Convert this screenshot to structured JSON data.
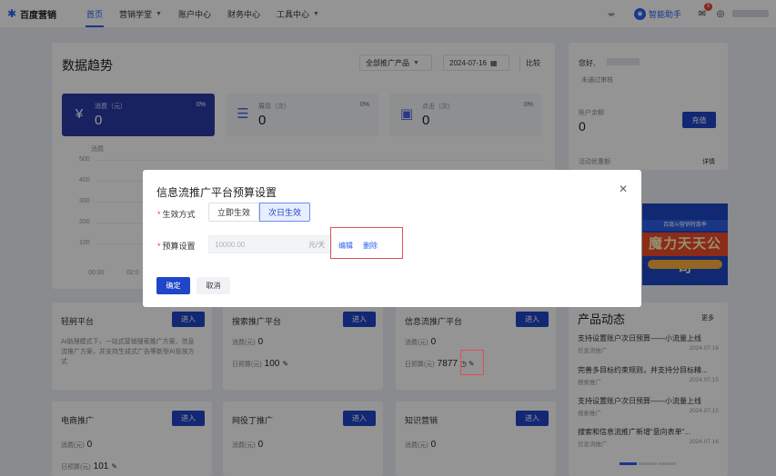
{
  "nav": {
    "logo_text": "百度营销",
    "items": [
      {
        "label": "首页",
        "active": true,
        "dropdown": false
      },
      {
        "label": "营销学堂",
        "active": false,
        "dropdown": true
      },
      {
        "label": "账户中心",
        "active": false,
        "dropdown": false
      },
      {
        "label": "财务中心",
        "active": false,
        "dropdown": false
      },
      {
        "label": "工具中心",
        "active": false,
        "dropdown": true
      }
    ],
    "assistant_label": "智能助手",
    "message_count": "5"
  },
  "trend": {
    "title": "数据趋势",
    "product_select": "全部推广产品",
    "date": "2024-07-16",
    "compare_label": "比较",
    "stats": [
      {
        "label": "消费（元）",
        "value": "0",
        "pct": "0%",
        "active": true
      },
      {
        "label": "展现（次）",
        "value": "0",
        "pct": "0%",
        "active": false
      },
      {
        "label": "点击（次）",
        "value": "0",
        "pct": "0%",
        "active": false
      }
    ],
    "chart_axis_title": "消费",
    "y_ticks": [
      "500",
      "400",
      "300",
      "200",
      "100"
    ],
    "x_ticks": [
      "00:00",
      "02:0"
    ]
  },
  "account": {
    "greeting": "您好,",
    "review_status": "未通过审核",
    "balance_label": "账户余额",
    "balance_value": "0",
    "recharge_label": "充值",
    "detail_label": "详情",
    "rebate_label": "活动优惠额"
  },
  "cards": [
    {
      "title": "轻舸平台",
      "enter": "进入",
      "desc": "AI助理模式下，一站式营销搜索推广方案、信息流推广方案，并支持生成式广告等新型AI投放方式"
    },
    {
      "title": "搜索推广平台",
      "enter": "进入",
      "spend_label": "消费(元)",
      "spend": "0",
      "budget_label": "日预算(元)",
      "budget": "100"
    },
    {
      "title": "信息流推广平台",
      "enter": "进入",
      "spend_label": "消费(元)",
      "spend": "0",
      "budget_label": "日预算(元)",
      "budget": "7877"
    },
    {
      "title": "电商推广",
      "enter": "进入",
      "spend_label": "消费(元)",
      "spend": "0",
      "budget_label": "日预算(元)",
      "budget": "101"
    },
    {
      "title": "网役丁推广",
      "enter": "进入",
      "spend_label": "消费(元)",
      "spend": "0"
    },
    {
      "title": "知识营销",
      "enter": "进入",
      "spend_label": "消费(元)",
      "spend": "0"
    }
  ],
  "news": {
    "title": "产品动态",
    "more": "更多",
    "items": [
      {
        "title": "支持设置账户次日预算——小流量上线",
        "tag": "信息流推广",
        "date": "2024.07.16"
      },
      {
        "title": "完善多目标约束规则，并支持分目标精...",
        "tag": "搜索推广",
        "date": "2024.07.15"
      },
      {
        "title": "支持设置账户次日预算——小流量上线",
        "tag": "搜索推广",
        "date": "2024.07.15"
      },
      {
        "title": "搜索和信息流推广新增“意向表单”...",
        "tag": "信息流推广",
        "date": "2024.07.16"
      }
    ]
  },
  "banner": {
    "top_text": "百度AI营销特惠季",
    "main_text": "魔力天天公司"
  },
  "modal": {
    "title": "信息流推广平台预算设置",
    "effect_label": "生效方式",
    "effect_options": [
      {
        "label": "立即生效",
        "selected": false
      },
      {
        "label": "次日生效",
        "selected": true
      }
    ],
    "budget_label": "预算设置",
    "budget_value": "10000.00",
    "budget_unit": "元/天",
    "edit_label": "编辑",
    "delete_label": "删除",
    "ok_label": "确定",
    "cancel_label": "取消"
  },
  "colors": {
    "brand": "#2a5df5",
    "primary_button": "#1f46c8",
    "highlight_box": "#e05050"
  }
}
